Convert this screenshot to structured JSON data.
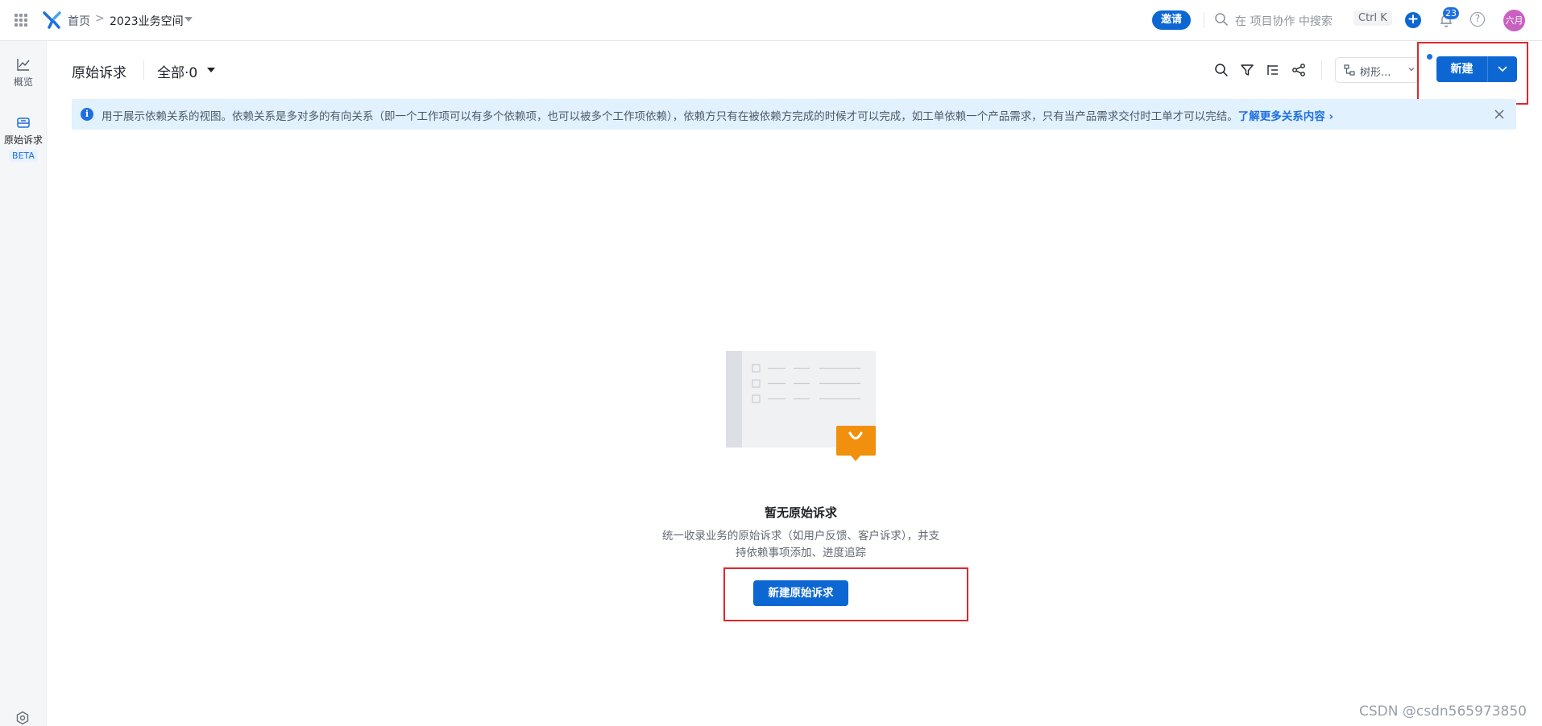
{
  "topbar": {
    "breadcrumb_home": "首页",
    "breadcrumb_sep": ">",
    "breadcrumb_space": "2023业务空间",
    "invite_label": "邀请",
    "search_placeholder": "在 项目协作 中搜索",
    "shortcut": "Ctrl K",
    "plus_label": "+",
    "notification_count": "23",
    "help_label": "?",
    "avatar_text": "六月"
  },
  "sidebar": {
    "items": [
      {
        "label": "概览",
        "icon": "chart-line-icon"
      },
      {
        "label": "原始诉求",
        "icon": "inbox-icon",
        "badge": "BETA"
      }
    ],
    "settings_icon": "settings-icon"
  },
  "header": {
    "title": "原始诉求",
    "filter_label": "全部·0",
    "view_select": "树形...",
    "new_button": "新建"
  },
  "banner": {
    "text": "用于展示依赖关系的视图。依赖关系是多对多的有向关系（即一个工作项可以有多个依赖项，也可以被多个工作项依赖），依赖方只有在被依赖方完成的时候才可以完成，如工单依赖一个产品需求，只有当产品需求交付时工单才可以完结。",
    "link": "了解更多关系内容 ›"
  },
  "empty_state": {
    "title": "暂无原始诉求",
    "desc_line1": "统一收录业务的原始诉求（如用户反馈、客户诉求），并支",
    "desc_line2": "持依赖事项添加、进度追踪",
    "button": "新建原始诉求"
  },
  "watermark": "CSDN @csdn565973850",
  "colors": {
    "primary": "#0c67d2",
    "banner_bg": "#e1f1fd",
    "highlight_red": "#e0262c",
    "avatar": "#c961c1",
    "illustration_orange": "#f0900c"
  }
}
